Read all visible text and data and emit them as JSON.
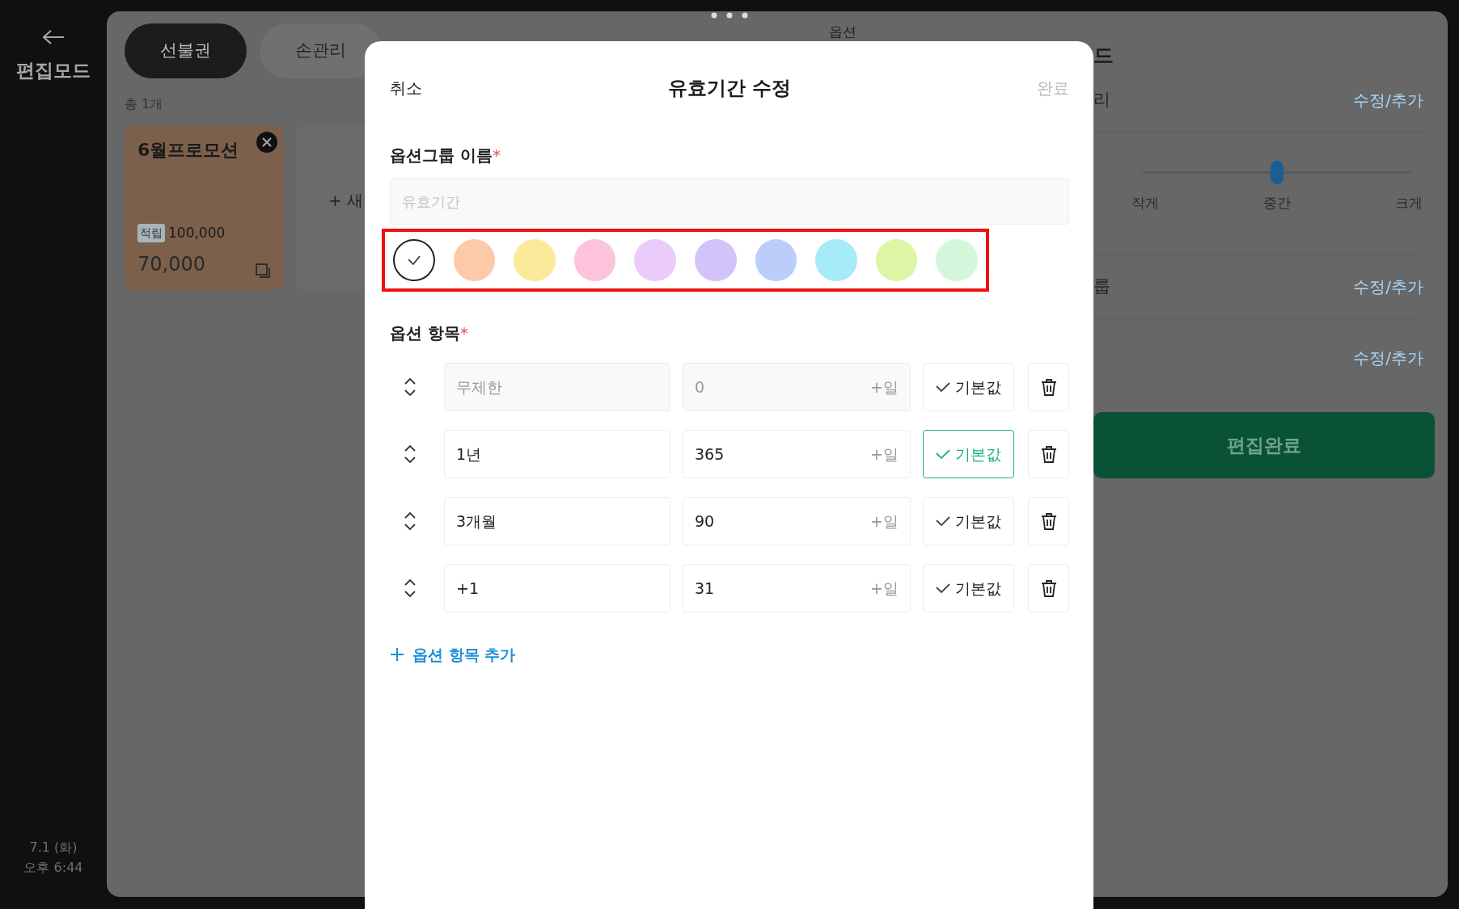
{
  "sidebar": {
    "title": "편집모드",
    "date": "7.1 (화)",
    "time": "오후 6:44"
  },
  "tabs": [
    {
      "label": "선불권",
      "selected": true
    },
    {
      "label": "손관리",
      "selected": false
    }
  ],
  "count": "총 1개",
  "cards": [
    {
      "title": "6월프로모션",
      "tag": "적립",
      "points": "100,000",
      "price": "70,000"
    }
  ],
  "new_card": "+ 새",
  "right_panel": {
    "section": "옵션",
    "heading": "드",
    "settings": [
      {
        "kind": "link",
        "label": "리",
        "action": "수정/추가"
      },
      {
        "kind": "slider",
        "level": 0.5,
        "ticks": [
          "작게",
          "중간",
          "크게"
        ]
      },
      {
        "kind": "link",
        "label": "룹",
        "action": "수정/추가"
      },
      {
        "kind": "link",
        "action": "수정/추가"
      }
    ],
    "done_button": "편집완료"
  },
  "modal": {
    "cancel": "취소",
    "title": "유효기간 수정",
    "confirm": "완료",
    "confirm_disabled": true,
    "name_label": "옵션그룹 이름",
    "name_required": "*",
    "name_field": {
      "placeholder": "유효기간"
    },
    "highlight_swatches": true,
    "swatches": [
      {
        "color": "#ffffff",
        "selected": true
      },
      {
        "color": "#fdcaa8",
        "selected": false
      },
      {
        "color": "#fde99a",
        "selected": false
      },
      {
        "color": "#fdc2dc",
        "selected": false
      },
      {
        "color": "#eacbf9",
        "selected": false
      },
      {
        "color": "#d3c3fb",
        "selected": false
      },
      {
        "color": "#bccdfb",
        "selected": false
      },
      {
        "color": "#a6ebf7",
        "selected": false
      },
      {
        "color": "#ddf6a6",
        "selected": false
      },
      {
        "color": "#d4f7db",
        "selected": false
      }
    ],
    "items_label": "옵션 항목",
    "items_required": "*",
    "items": [
      {
        "name": "무제한",
        "days": "0",
        "unit": "+일",
        "default_label": "기본값",
        "default": false,
        "disabled": true
      },
      {
        "name": "1년",
        "days": "365",
        "unit": "+일",
        "default_label": "기본값",
        "default": true,
        "disabled": false
      },
      {
        "name": "3개월",
        "days": "90",
        "unit": "+일",
        "default_label": "기본값",
        "default": false,
        "disabled": false
      },
      {
        "name": "+1",
        "days": "31",
        "unit": "+일",
        "default_label": "기본값",
        "default": false,
        "disabled": false
      }
    ],
    "add_item": "옵션 항목 추가"
  }
}
